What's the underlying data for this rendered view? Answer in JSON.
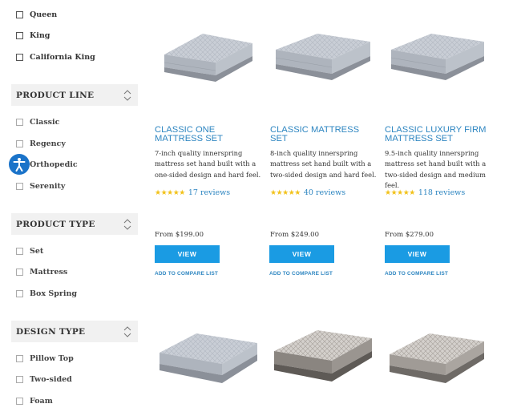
{
  "filters": {
    "size_items": [
      "Queen",
      "King",
      "California King"
    ],
    "product_line": {
      "title": "PRODUCT LINE",
      "items": [
        "Classic",
        "Regency",
        "Orthopedic",
        "Serenity"
      ]
    },
    "product_type": {
      "title": "PRODUCT TYPE",
      "items": [
        "Set",
        "Mattress",
        "Box Spring"
      ]
    },
    "design_type": {
      "title": "DESIGN TYPE",
      "items": [
        "Pillow Top",
        "Two-sided",
        "Foam"
      ]
    }
  },
  "products": [
    {
      "title": "CLASSIC ONE MATTRESS SET",
      "description": "7-inch quality innerspring mattress set hand built with a one-sided design and hard feel.",
      "stars": "★★★★★",
      "rating": 4.5,
      "reviews": "17 reviews",
      "price": "From $199.00",
      "view_label": "VIEW",
      "compare_label": "ADD TO COMPARE LIST"
    },
    {
      "title": "CLASSIC MATTRESS SET",
      "description": "8-inch quality innerspring mattress set hand built with a two-sided design and hard feel.",
      "stars": "★★★★★",
      "rating": 4.5,
      "reviews": "40 reviews",
      "price": "From $249.00",
      "view_label": "VIEW",
      "compare_label": "ADD TO COMPARE LIST"
    },
    {
      "title": "CLASSIC LUXURY FIRM MATTRESS SET",
      "description": "9.5-inch quality innerspring mattress set hand built with a two-sided design and medium feel.",
      "stars": "★★★★★",
      "rating": 5,
      "reviews": "118 reviews",
      "price": "From $279.00",
      "view_label": "VIEW",
      "compare_label": "ADD TO COMPARE LIST"
    }
  ],
  "colors": {
    "accent": "#2e86c1",
    "button": "#1a9be3",
    "star": "#f2c21b",
    "section_bg": "#f1f1f1",
    "a11y": "#1a73c9"
  },
  "icons": {
    "accessibility": "accessibility-icon",
    "sort": "chevron-up-down-icon"
  }
}
